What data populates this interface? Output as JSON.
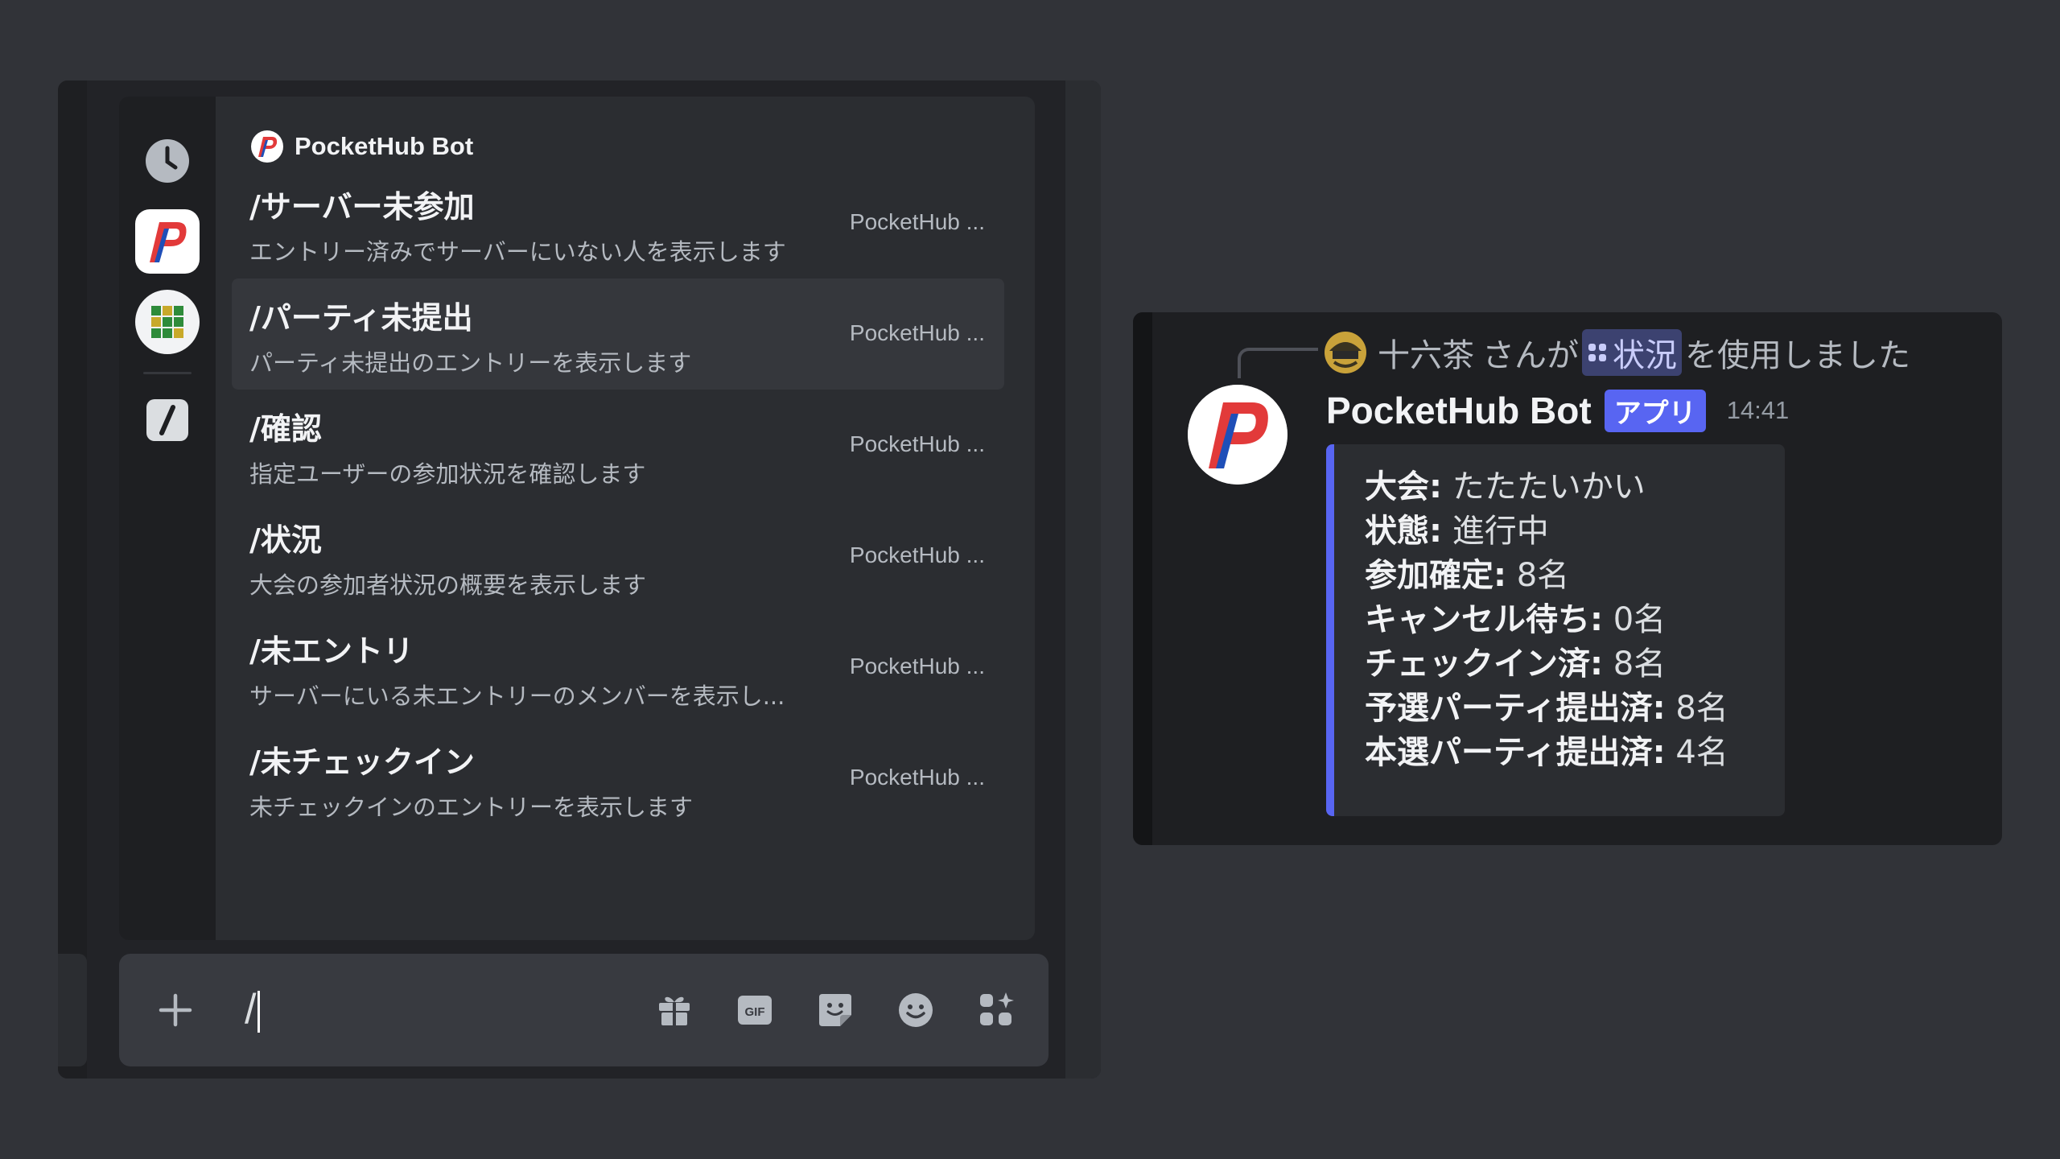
{
  "popup": {
    "bot_name": "PocketHub Bot",
    "commands": [
      {
        "name": "/サーバー未参加",
        "description": "エントリー済みでサーバーにいない人を表示します",
        "source": "PocketHub ...",
        "selected": false
      },
      {
        "name": "/パーティ未提出",
        "description": "パーティ未提出のエントリーを表示します",
        "source": "PocketHub ...",
        "selected": true
      },
      {
        "name": "/確認",
        "description": "指定ユーザーの参加状況を確認します",
        "source": "PocketHub ...",
        "selected": false
      },
      {
        "name": "/状況",
        "description": "大会の参加者状況の概要を表示します",
        "source": "PocketHub ...",
        "selected": false
      },
      {
        "name": "/未エントリ",
        "description": "サーバーにいる未エントリーのメンバーを表示し...",
        "source": "PocketHub ...",
        "selected": false
      },
      {
        "name": "/未チェックイン",
        "description": "未チェックインのエントリーを表示します",
        "source": "PocketHub ...",
        "selected": false
      }
    ],
    "rail_icons": [
      "clock-icon",
      "pockethub-app-icon",
      "grid-app-icon",
      "slash-commands-icon"
    ]
  },
  "chatbar": {
    "input_value": "/",
    "icons": [
      "plus-icon",
      "gift-icon",
      "gif-icon",
      "sticker-icon",
      "emoji-icon",
      "apps-icon"
    ],
    "gif_label": "GIF"
  },
  "message": {
    "reply": {
      "user": "十六茶",
      "middle": "さんが",
      "command": "状況",
      "suffix": "を使用しました"
    },
    "author": "PocketHub Bot",
    "badge": "アプリ",
    "time": "14:41",
    "embed": {
      "accent_color": "#5865f2",
      "fields": [
        {
          "label": "大会:",
          "value": "たたたいかい"
        },
        {
          "label": "状態:",
          "value": "進行中"
        },
        {
          "label": "参加確定:",
          "value": "8名"
        },
        {
          "label": "キャンセル待ち:",
          "value": "0名"
        },
        {
          "label": "チェックイン済:",
          "value": "8名"
        },
        {
          "label": "予選パーティ提出済:",
          "value": "8名"
        },
        {
          "label": "本選パーティ提出済:",
          "value": "4名"
        }
      ]
    }
  },
  "colors": {
    "background": "#313338",
    "brand": "#5865f2",
    "logo_red": "#e23a3a",
    "logo_blue": "#1f4fb8"
  }
}
